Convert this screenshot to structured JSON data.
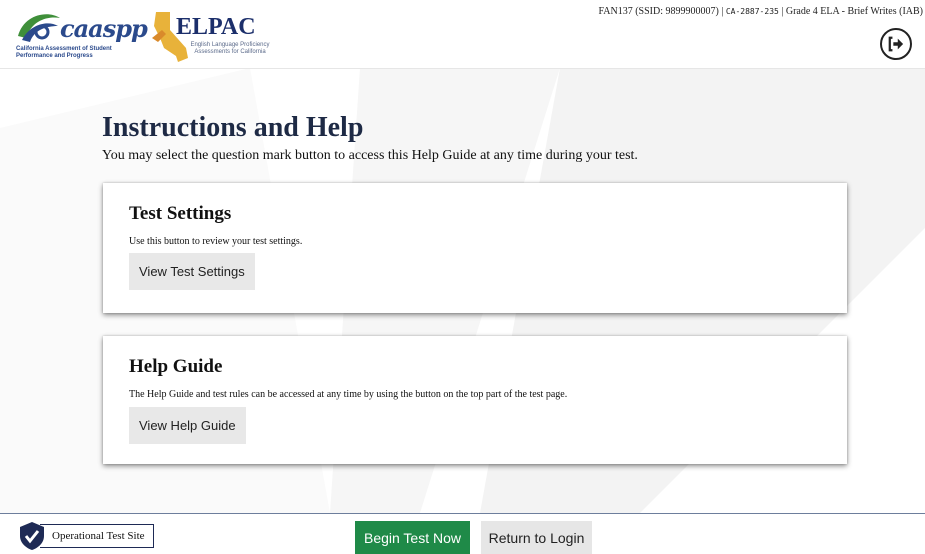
{
  "header": {
    "caaspp_logo": {
      "wordmark": "caaspp",
      "subtitle": "California Assessment of Student Performance and Progress"
    },
    "elpac_logo": {
      "wordmark": "ELPAC",
      "subtitle": "English Language Proficiency Assessments for California"
    },
    "session": {
      "student": "FAN137 (SSID: 9899900007)",
      "separator1": "|",
      "session_id": "CA-2887-235",
      "separator2": "|",
      "test_name": "Grade 4 ELA - Brief Writes (IAB)"
    },
    "logout_icon": "exit-arrow-icon"
  },
  "main": {
    "title": "Instructions and Help",
    "subtitle": "You may select the question mark button to access this Help Guide at any time during your test.",
    "cards": [
      {
        "heading": "Test Settings",
        "description": "Use this button to review your test settings.",
        "button_label": "View Test Settings"
      },
      {
        "heading": "Help Guide",
        "description": "The Help Guide and test rules can be accessed at any time by using the button on the top part of the test page.",
        "button_label": "View Help Guide"
      }
    ]
  },
  "footer": {
    "site_label": "Operational Test Site",
    "site_icon": "shield-check-icon",
    "begin_label": "Begin Test Now",
    "return_label": "Return to Login"
  },
  "colors": {
    "begin_button": "#1f8a48",
    "title": "#1e2a45",
    "brand_blue": "#2b4a8c",
    "elpac_gold": "#e8b23a"
  }
}
